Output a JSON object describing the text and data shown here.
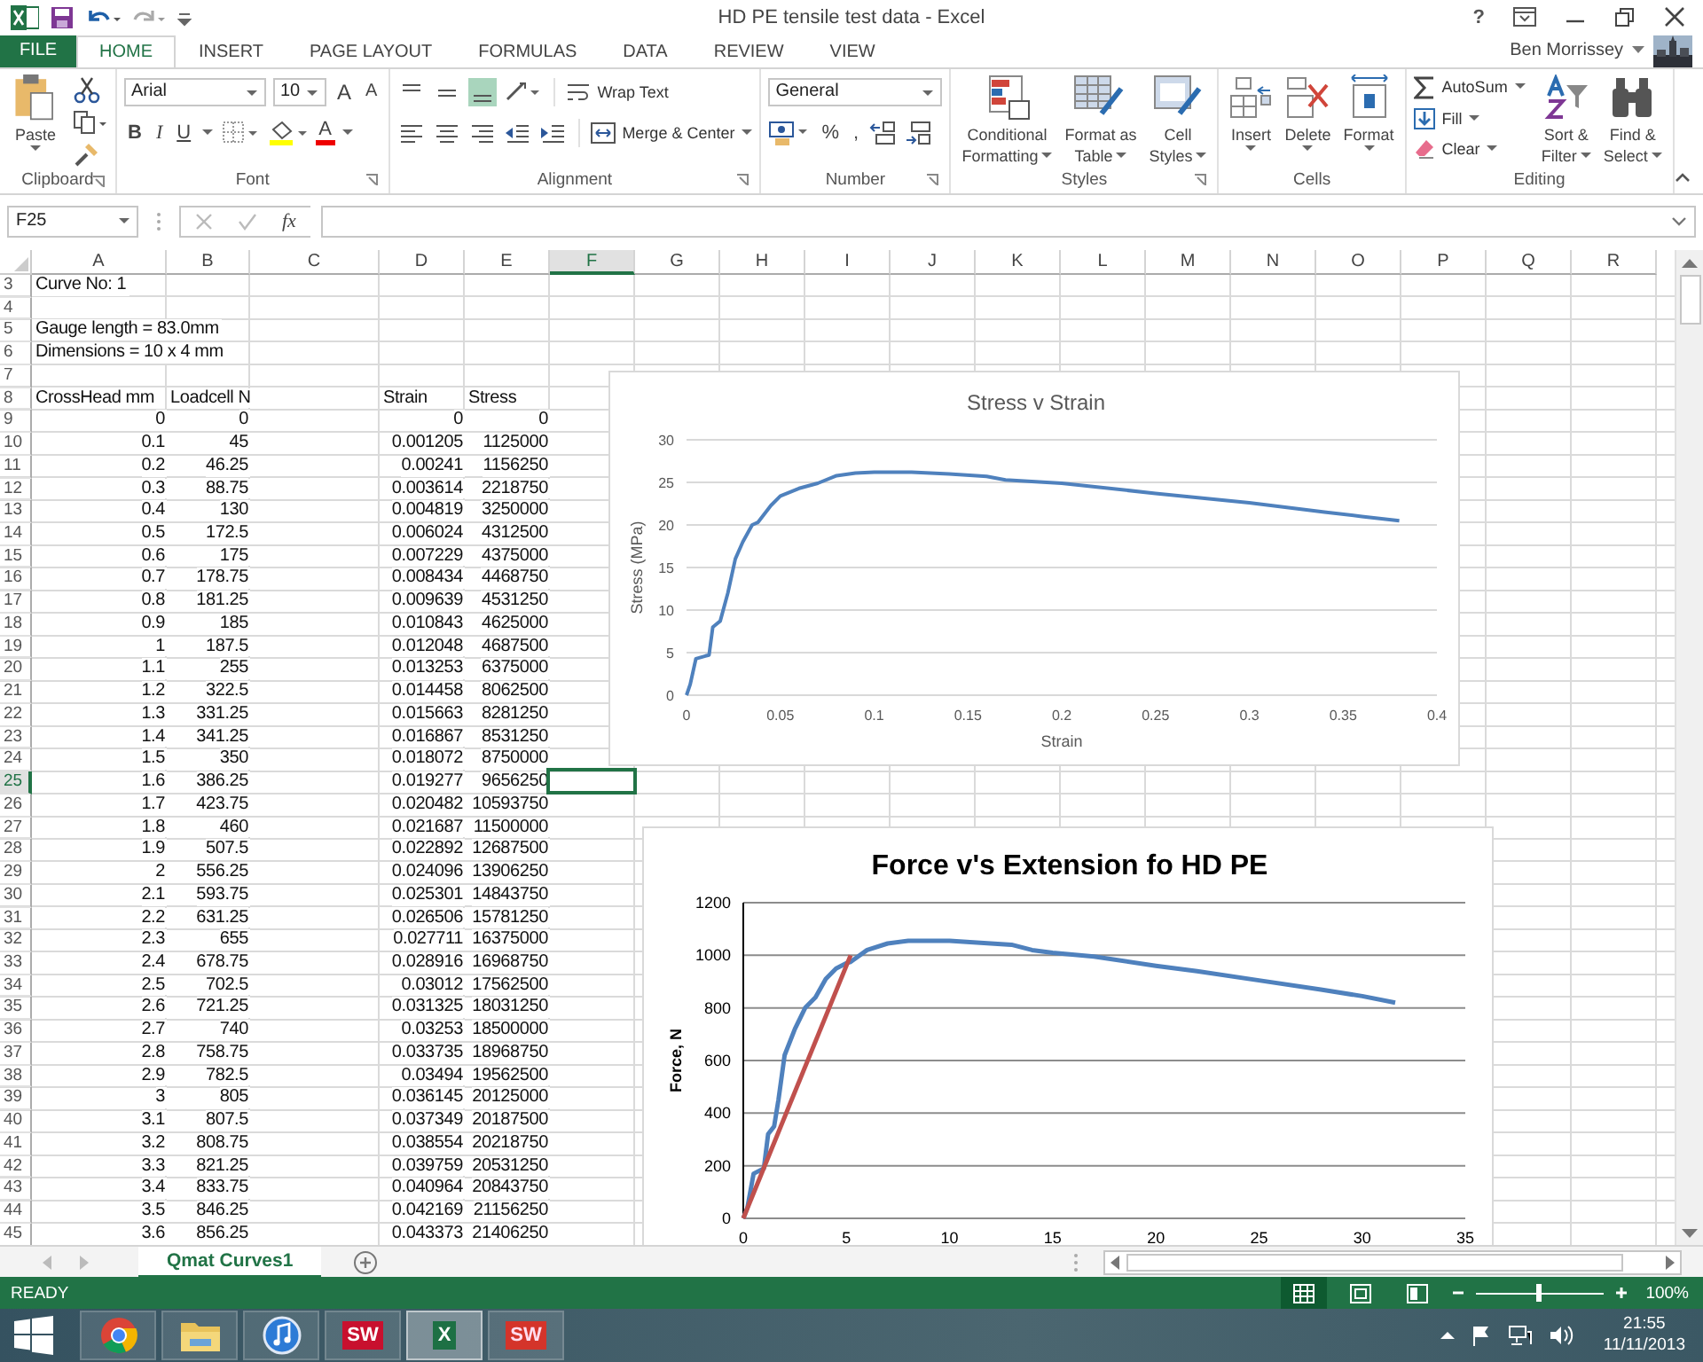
{
  "window": {
    "title": "HD PE tensile test data - Excel",
    "help": "?"
  },
  "ribbon_tabs": [
    {
      "label": "FILE",
      "kind": "file",
      "selected": false
    },
    {
      "label": "HOME",
      "kind": "tab",
      "selected": true
    },
    {
      "label": "INSERT",
      "kind": "tab",
      "selected": false
    },
    {
      "label": "PAGE LAYOUT",
      "kind": "tab",
      "selected": false
    },
    {
      "label": "FORMULAS",
      "kind": "tab",
      "selected": false
    },
    {
      "label": "DATA",
      "kind": "tab",
      "selected": false
    },
    {
      "label": "REVIEW",
      "kind": "tab",
      "selected": false
    },
    {
      "label": "VIEW",
      "kind": "tab",
      "selected": false
    }
  ],
  "user": {
    "name": "Ben Morrissey"
  },
  "clipboard": {
    "paste": "Paste",
    "label": "Clipboard"
  },
  "font": {
    "name": "Arial",
    "size": "10",
    "grow": "A",
    "shrink": "A",
    "bold": "B",
    "italic": "I",
    "underline": "U",
    "color_glyph": "A",
    "label": "Font"
  },
  "alignment": {
    "vertical": [
      {
        "selected": false
      },
      {
        "selected": false
      },
      {
        "selected": true
      }
    ],
    "wrap": "Wrap Text",
    "merge": "Merge & Center",
    "label": "Alignment"
  },
  "number": {
    "format": "General",
    "percent": "%",
    "comma": ",",
    "label": "Number"
  },
  "styles": {
    "buttons": [
      {
        "kind": "conditional",
        "lines": [
          "Conditional",
          "Formatting"
        ]
      },
      {
        "kind": "table",
        "lines": [
          "Format as",
          "Table"
        ]
      },
      {
        "kind": "cell",
        "lines": [
          "Cell",
          "Styles"
        ]
      }
    ],
    "label": "Styles"
  },
  "cells": {
    "buttons": [
      {
        "kind": "insert",
        "label": "Insert"
      },
      {
        "kind": "delete",
        "label": "Delete"
      },
      {
        "kind": "format",
        "label": "Format"
      }
    ],
    "label": "Cells"
  },
  "editing": {
    "autosum": "AutoSum",
    "fill": "Fill",
    "clear": "Clear",
    "buttons": [
      {
        "kind": "sort",
        "lines": [
          "Sort &",
          "Filter"
        ]
      },
      {
        "kind": "find",
        "lines": [
          "Find &",
          "Select"
        ]
      }
    ],
    "label": "Editing"
  },
  "formula_bar": {
    "name_box": "F25",
    "function": "fx"
  },
  "sheet": {
    "columns": [
      {
        "label": "A",
        "selected": false
      },
      {
        "label": "B",
        "selected": false
      },
      {
        "label": "C",
        "selected": false
      },
      {
        "label": "D",
        "selected": false
      },
      {
        "label": "E",
        "selected": false
      },
      {
        "label": "F",
        "selected": true
      },
      {
        "label": "G",
        "selected": false
      },
      {
        "label": "H",
        "selected": false
      },
      {
        "label": "I",
        "selected": false
      },
      {
        "label": "J",
        "selected": false
      },
      {
        "label": "K",
        "selected": false
      },
      {
        "label": "L",
        "selected": false
      },
      {
        "label": "M",
        "selected": false
      },
      {
        "label": "N",
        "selected": false
      },
      {
        "label": "O",
        "selected": false
      },
      {
        "label": "P",
        "selected": false
      },
      {
        "label": "Q",
        "selected": false
      },
      {
        "label": "R",
        "selected": false
      }
    ],
    "rows": [
      {
        "row": "3",
        "kind": "text",
        "selected": false,
        "col_a": "Curve No: 1"
      },
      {
        "row": "4",
        "selected": false
      },
      {
        "row": "5",
        "kind": "text",
        "selected": false,
        "col_a": "Gauge length = 83.0mm"
      },
      {
        "row": "6",
        "kind": "text",
        "selected": false,
        "col_a": "Dimensions = 10 x 4 mm"
      },
      {
        "row": "7",
        "selected": false
      },
      {
        "row": "8",
        "kind": "text",
        "selected": false,
        "col_a": "CrossHead mm",
        "col_b": "Loadcell N",
        "col_d": "Strain",
        "col_e": "Stress"
      },
      {
        "row": "9",
        "kind": "numeric",
        "selected": false,
        "col_a": "0",
        "col_b": "0",
        "col_d": "0",
        "col_e": "0"
      },
      {
        "row": "10",
        "kind": "numeric",
        "selected": false,
        "col_a": "0.1",
        "col_b": "45",
        "col_d": "0.001205",
        "col_e": "1125000"
      },
      {
        "row": "11",
        "kind": "numeric",
        "selected": false,
        "col_a": "0.2",
        "col_b": "46.25",
        "col_d": "0.00241",
        "col_e": "1156250"
      },
      {
        "row": "12",
        "kind": "numeric",
        "selected": false,
        "col_a": "0.3",
        "col_b": "88.75",
        "col_d": "0.003614",
        "col_e": "2218750"
      },
      {
        "row": "13",
        "kind": "numeric",
        "selected": false,
        "col_a": "0.4",
        "col_b": "130",
        "col_d": "0.004819",
        "col_e": "3250000"
      },
      {
        "row": "14",
        "kind": "numeric",
        "selected": false,
        "col_a": "0.5",
        "col_b": "172.5",
        "col_d": "0.006024",
        "col_e": "4312500"
      },
      {
        "row": "15",
        "kind": "numeric",
        "selected": false,
        "col_a": "0.6",
        "col_b": "175",
        "col_d": "0.007229",
        "col_e": "4375000"
      },
      {
        "row": "16",
        "kind": "numeric",
        "selected": false,
        "col_a": "0.7",
        "col_b": "178.75",
        "col_d": "0.008434",
        "col_e": "4468750"
      },
      {
        "row": "17",
        "kind": "numeric",
        "selected": false,
        "col_a": "0.8",
        "col_b": "181.25",
        "col_d": "0.009639",
        "col_e": "4531250"
      },
      {
        "row": "18",
        "kind": "numeric",
        "selected": false,
        "col_a": "0.9",
        "col_b": "185",
        "col_d": "0.010843",
        "col_e": "4625000"
      },
      {
        "row": "19",
        "kind": "numeric",
        "selected": false,
        "col_a": "1",
        "col_b": "187.5",
        "col_d": "0.012048",
        "col_e": "4687500"
      },
      {
        "row": "20",
        "kind": "numeric",
        "selected": false,
        "col_a": "1.1",
        "col_b": "255",
        "col_d": "0.013253",
        "col_e": "6375000"
      },
      {
        "row": "21",
        "kind": "numeric",
        "selected": false,
        "col_a": "1.2",
        "col_b": "322.5",
        "col_d": "0.014458",
        "col_e": "8062500"
      },
      {
        "row": "22",
        "kind": "numeric",
        "selected": false,
        "col_a": "1.3",
        "col_b": "331.25",
        "col_d": "0.015663",
        "col_e": "8281250"
      },
      {
        "row": "23",
        "kind": "numeric",
        "selected": false,
        "col_a": "1.4",
        "col_b": "341.25",
        "col_d": "0.016867",
        "col_e": "8531250"
      },
      {
        "row": "24",
        "kind": "numeric",
        "selected": false,
        "col_a": "1.5",
        "col_b": "350",
        "col_d": "0.018072",
        "col_e": "8750000"
      },
      {
        "row": "25",
        "kind": "numeric",
        "selected": true,
        "col_a": "1.6",
        "col_b": "386.25",
        "col_d": "0.019277",
        "col_e": "9656250"
      },
      {
        "row": "26",
        "kind": "numeric",
        "selected": false,
        "col_a": "1.7",
        "col_b": "423.75",
        "col_d": "0.020482",
        "col_e": "10593750"
      },
      {
        "row": "27",
        "kind": "numeric",
        "selected": false,
        "col_a": "1.8",
        "col_b": "460",
        "col_d": "0.021687",
        "col_e": "11500000"
      },
      {
        "row": "28",
        "kind": "numeric",
        "selected": false,
        "col_a": "1.9",
        "col_b": "507.5",
        "col_d": "0.022892",
        "col_e": "12687500"
      },
      {
        "row": "29",
        "kind": "numeric",
        "selected": false,
        "col_a": "2",
        "col_b": "556.25",
        "col_d": "0.024096",
        "col_e": "13906250"
      },
      {
        "row": "30",
        "kind": "numeric",
        "selected": false,
        "col_a": "2.1",
        "col_b": "593.75",
        "col_d": "0.025301",
        "col_e": "14843750"
      },
      {
        "row": "31",
        "kind": "numeric",
        "selected": false,
        "col_a": "2.2",
        "col_b": "631.25",
        "col_d": "0.026506",
        "col_e": "15781250"
      },
      {
        "row": "32",
        "kind": "numeric",
        "selected": false,
        "col_a": "2.3",
        "col_b": "655",
        "col_d": "0.027711",
        "col_e": "16375000"
      },
      {
        "row": "33",
        "kind": "numeric",
        "selected": false,
        "col_a": "2.4",
        "col_b": "678.75",
        "col_d": "0.028916",
        "col_e": "16968750"
      },
      {
        "row": "34",
        "kind": "numeric",
        "selected": false,
        "col_a": "2.5",
        "col_b": "702.5",
        "col_d": "0.03012",
        "col_e": "17562500"
      },
      {
        "row": "35",
        "kind": "numeric",
        "selected": false,
        "col_a": "2.6",
        "col_b": "721.25",
        "col_d": "0.031325",
        "col_e": "18031250"
      },
      {
        "row": "36",
        "kind": "numeric",
        "selected": false,
        "col_a": "2.7",
        "col_b": "740",
        "col_d": "0.03253",
        "col_e": "18500000"
      },
      {
        "row": "37",
        "kind": "numeric",
        "selected": false,
        "col_a": "2.8",
        "col_b": "758.75",
        "col_d": "0.033735",
        "col_e": "18968750"
      },
      {
        "row": "38",
        "kind": "numeric",
        "selected": false,
        "col_a": "2.9",
        "col_b": "782.5",
        "col_d": "0.03494",
        "col_e": "19562500"
      },
      {
        "row": "39",
        "kind": "numeric",
        "selected": false,
        "col_a": "3",
        "col_b": "805",
        "col_d": "0.036145",
        "col_e": "20125000"
      },
      {
        "row": "40",
        "kind": "numeric",
        "selected": false,
        "col_a": "3.1",
        "col_b": "807.5",
        "col_d": "0.037349",
        "col_e": "20187500"
      },
      {
        "row": "41",
        "kind": "numeric",
        "selected": false,
        "col_a": "3.2",
        "col_b": "808.75",
        "col_d": "0.038554",
        "col_e": "20218750"
      },
      {
        "row": "42",
        "kind": "numeric",
        "selected": false,
        "col_a": "3.3",
        "col_b": "821.25",
        "col_d": "0.039759",
        "col_e": "20531250"
      },
      {
        "row": "43",
        "kind": "numeric",
        "selected": false,
        "col_a": "3.4",
        "col_b": "833.75",
        "col_d": "0.040964",
        "col_e": "20843750"
      },
      {
        "row": "44",
        "kind": "numeric",
        "selected": false,
        "col_a": "3.5",
        "col_b": "846.25",
        "col_d": "0.042169",
        "col_e": "21156250"
      },
      {
        "row": "45",
        "kind": "numeric",
        "selected": false,
        "col_a": "3.6",
        "col_b": "856.25",
        "col_d": "0.043373",
        "col_e": "21406250"
      }
    ]
  },
  "charts": [
    {
      "chart_data": {
        "type": "line",
        "title": "Stress v Strain",
        "xlabel": "Strain",
        "ylabel": "Stress (MPa)",
        "x": [
          0,
          0.002,
          0.005,
          0.01,
          0.012,
          0.014,
          0.018,
          0.022,
          0.026,
          0.03,
          0.035,
          0.038,
          0.045,
          0.05,
          0.06,
          0.07,
          0.08,
          0.09,
          0.1,
          0.12,
          0.14,
          0.16,
          0.17,
          0.2,
          0.25,
          0.3,
          0.34,
          0.36,
          0.38
        ],
        "series": [
          {
            "color": "#4f81bd",
            "values": [
              0,
              1.3,
              4.3,
              4.6,
              4.7,
              8,
              8.7,
              12,
              16,
              18,
              20,
              20.3,
              22.3,
              23.4,
              24.3,
              24.9,
              25.8,
              26.1,
              26.2,
              26.2,
              26,
              25.7,
              25.3,
              24.9,
              23.7,
              22.6,
              21.5,
              21,
              20.5
            ]
          }
        ],
        "grid": true,
        "xlim": [
          0,
          0.4
        ],
        "ylim": [
          0,
          30
        ],
        "xticks": [
          0,
          0.05,
          0.1,
          0.15,
          0.2,
          0.25,
          0.3,
          0.35,
          0.4
        ],
        "yticks": [
          0,
          5,
          10,
          15,
          20,
          25,
          30
        ]
      }
    },
    {
      "chart_data": {
        "type": "line",
        "title": "Force v's Extension fo HD PE",
        "ylabel": "Force, N",
        "x": [
          0,
          0.2,
          0.5,
          1,
          1.2,
          1.5,
          1.7,
          2,
          2.5,
          3,
          3.5,
          4,
          4.5,
          5,
          5.2,
          6,
          7,
          8,
          10,
          12,
          13,
          14,
          15,
          17,
          20,
          22,
          25,
          28,
          30,
          31.6
        ],
        "series": [
          {
            "color": "#4f81bd",
            "values": [
              0,
              40,
              170,
              190,
              320,
              350,
              450,
              620,
              720,
              800,
              840,
              910,
              950,
              970,
              975,
              1020,
              1045,
              1055,
              1055,
              1045,
              1040,
              1020,
              1010,
              995,
              960,
              940,
              905,
              870,
              845,
              820
            ]
          },
          {
            "color": "#c0504d",
            "values": [
              0,
              null,
              null,
              null,
              null,
              null,
              null,
              null,
              null,
              null,
              null,
              null,
              null,
              null,
              1000,
              null,
              null,
              null,
              null,
              null,
              null,
              null,
              null,
              null,
              null,
              null,
              null,
              null,
              null,
              null
            ]
          }
        ],
        "grid": true,
        "xlim": [
          0,
          35
        ],
        "ylim": [
          0,
          1200
        ],
        "xticks": [
          0,
          5,
          10,
          15,
          20,
          25,
          30,
          35
        ],
        "yticks": [
          0,
          200,
          400,
          600,
          800,
          1000,
          1200
        ]
      }
    }
  ],
  "sheet_tabs": [
    {
      "label": "Qmat Curves1",
      "selected": true
    }
  ],
  "status_bar": {
    "mode": "READY",
    "views": [
      {
        "kind": "normal",
        "selected": true
      },
      {
        "kind": "page_layout",
        "selected": false
      },
      {
        "kind": "page_break",
        "selected": false
      }
    ],
    "zoom": {
      "level": 0.5,
      "reading": "100%"
    }
  },
  "taskbar": {
    "apps": [
      {
        "kind": "chrome",
        "selected": false
      },
      {
        "kind": "folder",
        "selected": false
      },
      {
        "kind": "music",
        "selected": false
      },
      {
        "kind": "solidworks",
        "badge": "SW",
        "selected": false
      },
      {
        "kind": "excel",
        "badge": "X",
        "selected": true
      },
      {
        "kind": "solidworks_help",
        "badge": "SW",
        "selected": false
      }
    ],
    "time": "21:55",
    "date": "11/11/2013"
  }
}
